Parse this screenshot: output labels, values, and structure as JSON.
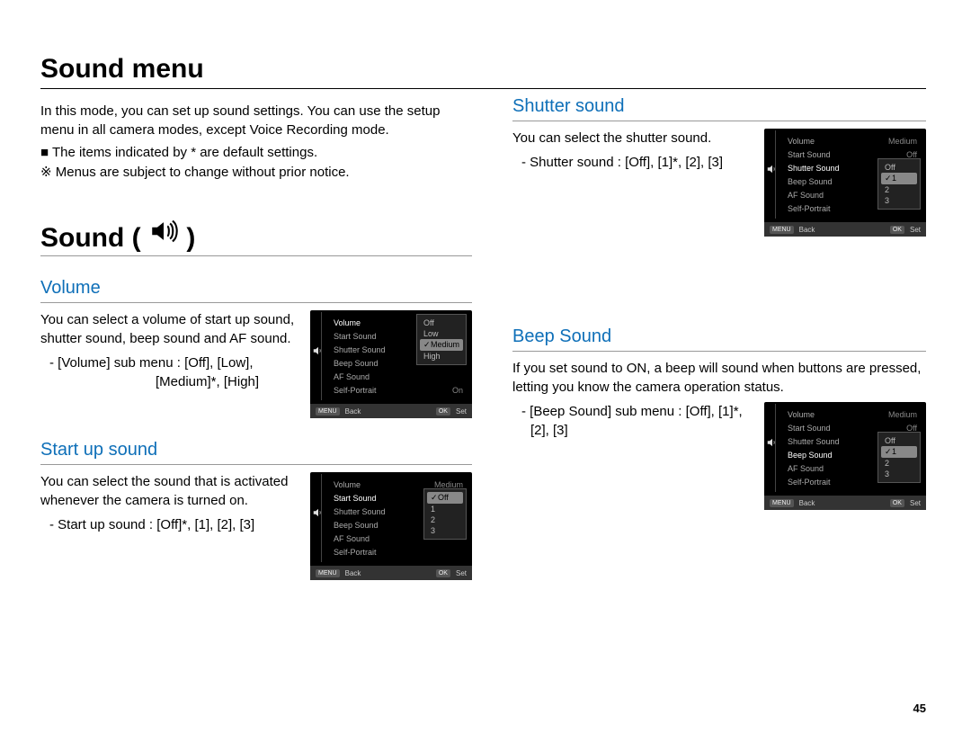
{
  "title": "Sound menu",
  "intro": "In this mode, you can set up sound settings. You can use the setup menu in all camera modes, except Voice Recording mode.",
  "note1": "■ The items indicated by * are default settings.",
  "note2": "※ Menus are subject to change without prior notice.",
  "sound_heading": "Sound (",
  "sound_heading_close": ")",
  "page_number": "45",
  "volume": {
    "heading": "Volume",
    "desc": "You can select a volume of start up sound, shutter sound, beep sound and AF sound.",
    "sub_open": "- [Volume] sub menu : [Off], [Low],",
    "sub_tail": "[Medium]*, [High]"
  },
  "startup": {
    "heading": "Start up sound",
    "desc": "You can select the sound that is activated whenever the camera is turned on.",
    "sub": "- Start up sound : [Off]*, [1], [2], [3]"
  },
  "shutter": {
    "heading": "Shutter sound",
    "desc": "You can select the shutter sound.",
    "sub": "- Shutter sound : [Off], [1]*, [2], [3]"
  },
  "beep": {
    "heading": "Beep Sound",
    "desc": "If you set sound to ON, a beep will sound when buttons are pressed, letting you know the camera operation status.",
    "sub": "- [Beep Sound] sub menu : [Off], [1]*, [2], [3]"
  },
  "cam": {
    "footer_back_tag": "MENU",
    "footer_back": "Back",
    "footer_set_tag": "OK",
    "footer_set": "Set",
    "menu_items": [
      "Volume",
      "Start Sound",
      "Shutter Sound",
      "Beep Sound",
      "AF Sound",
      "Self-Portrait"
    ],
    "right_vals": {
      "medium": "Medium",
      "off": "Off",
      "on": "On"
    },
    "volume_popup": [
      "Off",
      "Low",
      "Medium",
      "High"
    ],
    "volume_selected": "Medium",
    "startup_popup": [
      "Off",
      "1",
      "2",
      "3"
    ],
    "startup_selected": "Off",
    "startup_checked": "Off",
    "shutter_popup": [
      "Off",
      "1",
      "2",
      "3"
    ],
    "shutter_selected": "1",
    "shutter_checked": "1",
    "beep_popup": [
      "Off",
      "1",
      "2",
      "3"
    ],
    "beep_selected": "1",
    "beep_checked": "1"
  }
}
